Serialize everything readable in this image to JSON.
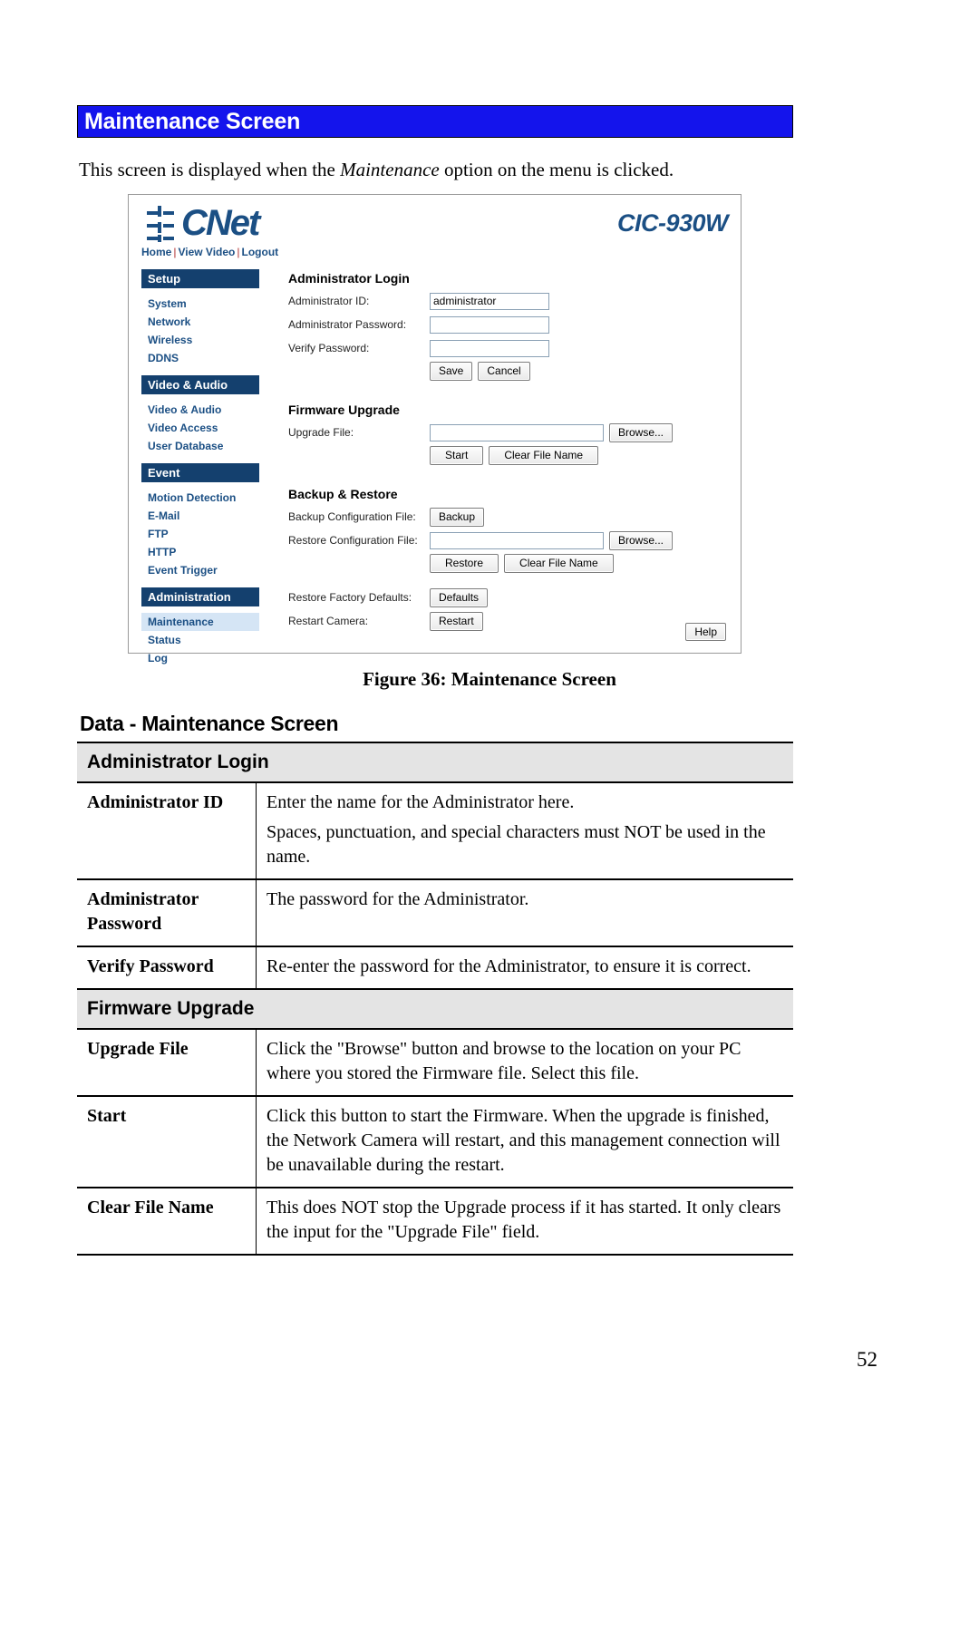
{
  "document": {
    "heading": "Maintenance Screen",
    "intro_before": "This screen is displayed when the ",
    "intro_italic": "Maintenance",
    "intro_after": " option on the menu is clicked.",
    "figure_caption": "Figure 36: Maintenance Screen",
    "data_heading": "Data - Maintenance Screen",
    "page_number": "52"
  },
  "colors": {
    "heading_bar_bg": "#1414ec",
    "heading_bar_text": "#ffffff",
    "brand_blue": "#1b4f84",
    "sidebar_header_bg": "#14406e",
    "sidebar_active_bg": "#d5e5f5",
    "table_group_bg": "#e4e4e4"
  },
  "figure": {
    "brand": "CNet",
    "model": "CIC-930W",
    "top_links": [
      {
        "label": "Home"
      },
      {
        "label": "View Video"
      },
      {
        "label": "Logout"
      }
    ],
    "top_links_separator": "|",
    "sidebar": [
      {
        "type": "header",
        "label": "Setup"
      },
      {
        "type": "item",
        "label": "System",
        "active": false
      },
      {
        "type": "item",
        "label": "Network",
        "active": false
      },
      {
        "type": "item",
        "label": "Wireless",
        "active": false
      },
      {
        "type": "item",
        "label": "DDNS",
        "active": false
      },
      {
        "type": "header",
        "label": "Video & Audio"
      },
      {
        "type": "item",
        "label": "Video & Audio",
        "active": false
      },
      {
        "type": "item",
        "label": "Video Access",
        "active": false
      },
      {
        "type": "item",
        "label": "User Database",
        "active": false
      },
      {
        "type": "header",
        "label": "Event"
      },
      {
        "type": "item",
        "label": "Motion Detection",
        "active": false
      },
      {
        "type": "item",
        "label": "E-Mail",
        "active": false
      },
      {
        "type": "item",
        "label": "FTP",
        "active": false
      },
      {
        "type": "item",
        "label": "HTTP",
        "active": false
      },
      {
        "type": "item",
        "label": "Event Trigger",
        "active": false
      },
      {
        "type": "header",
        "label": "Administration"
      },
      {
        "type": "item",
        "label": "Maintenance",
        "active": true
      },
      {
        "type": "item",
        "label": "Status",
        "active": false
      },
      {
        "type": "item",
        "label": "Log",
        "active": false
      }
    ],
    "admin_login": {
      "title": "Administrator Login",
      "id_label": "Administrator ID:",
      "id_value": "administrator",
      "password_label": "Administrator Password:",
      "password_value": "",
      "verify_label": "Verify Password:",
      "verify_value": "",
      "save_button": "Save",
      "cancel_button": "Cancel"
    },
    "firmware_upgrade": {
      "title": "Firmware Upgrade",
      "file_label": "Upgrade File:",
      "file_value": "",
      "browse_button": "Browse...",
      "start_button": "Start",
      "clear_button": "Clear File Name"
    },
    "backup_restore": {
      "title": "Backup & Restore",
      "backup_label": "Backup Configuration File:",
      "backup_button": "Backup",
      "restore_label": "Restore Configuration File:",
      "restore_value": "",
      "restore_browse_button": "Browse...",
      "restore_button": "Restore",
      "clear_button": "Clear File Name",
      "defaults_label": "Restore Factory Defaults:",
      "defaults_button": "Defaults",
      "restart_label": "Restart Camera:",
      "restart_button": "Restart"
    },
    "help_button": "Help"
  },
  "table": {
    "rows": [
      {
        "kind": "group",
        "label": "Administrator Login"
      },
      {
        "kind": "data",
        "key": "Administrator ID",
        "paragraphs": [
          "Enter the name for the Administrator here.",
          "Spaces, punctuation, and special characters must NOT be used in the name."
        ]
      },
      {
        "kind": "data",
        "key": "Administrator Password",
        "paragraphs": [
          "The password for the Administrator."
        ]
      },
      {
        "kind": "data",
        "key": "Verify Password",
        "paragraphs": [
          "Re-enter the password for the Administrator, to ensure it is correct."
        ]
      },
      {
        "kind": "group",
        "label": "Firmware Upgrade"
      },
      {
        "kind": "data",
        "key": "Upgrade File",
        "paragraphs": [
          "Click the \"Browse\" button and browse to the location on your PC where you stored the Firmware file. Select this file."
        ]
      },
      {
        "kind": "data",
        "key": "Start",
        "paragraphs": [
          "Click this button to start the Firmware. When the upgrade is finished, the Network Camera will restart, and this management connection will be unavailable during the restart."
        ]
      },
      {
        "kind": "data",
        "key": "Clear File Name",
        "paragraphs": [
          "This does NOT stop the Upgrade process if it has started. It only clears the input for the \"Upgrade File\" field."
        ]
      }
    ]
  }
}
